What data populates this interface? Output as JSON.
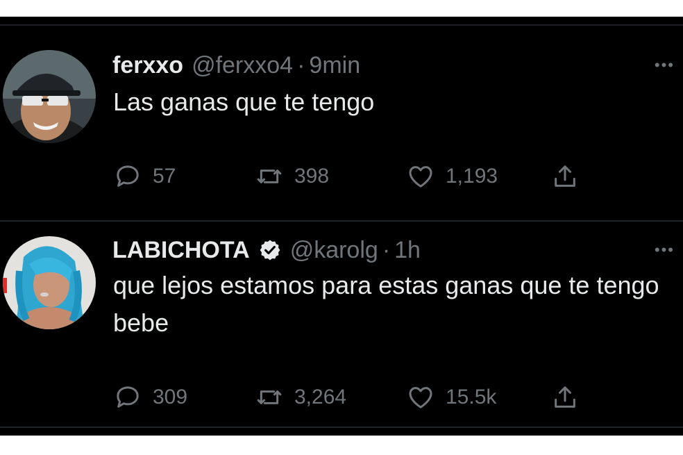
{
  "tweets": [
    {
      "name": "ferxxo",
      "handle": "@ferxxo4",
      "separator": "·",
      "time": "9min",
      "text": "Las ganas que te tengo",
      "verified": false,
      "replies": "57",
      "retweets": "398",
      "likes": "1,193",
      "more": "•••"
    },
    {
      "name": "LABICHOTA",
      "handle": "@karolg",
      "separator": "·",
      "time": "1h",
      "text": "que lejos estamos para estas ganas que te tengo bebe",
      "verified": true,
      "replies": "309",
      "retweets": "3,264",
      "likes": "15.5k",
      "more": "•••"
    }
  ],
  "colors": {
    "background": "#000000",
    "primary_text": "#e7e9ea",
    "secondary_text": "#71767b",
    "divider": "#1f2326"
  },
  "icons": [
    "reply-icon",
    "retweet-icon",
    "like-icon",
    "share-icon",
    "verified-badge-icon",
    "more-icon"
  ]
}
